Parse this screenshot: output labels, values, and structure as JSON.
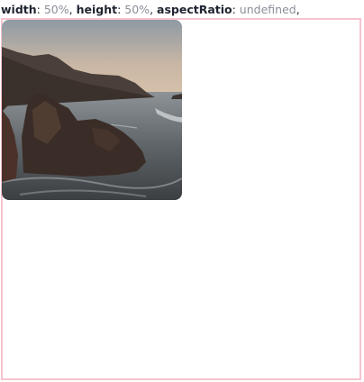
{
  "caption": {
    "items": [
      {
        "key": "width",
        "value": "50%"
      },
      {
        "key": "height",
        "value": "50%"
      },
      {
        "key": "aspectRatio",
        "value": "undefined"
      }
    ],
    "separator": ", ",
    "colon": ": "
  },
  "colors": {
    "frame_border": "#f7c3cf",
    "key_text": "#1f2430",
    "value_text": "#8a8f98"
  }
}
